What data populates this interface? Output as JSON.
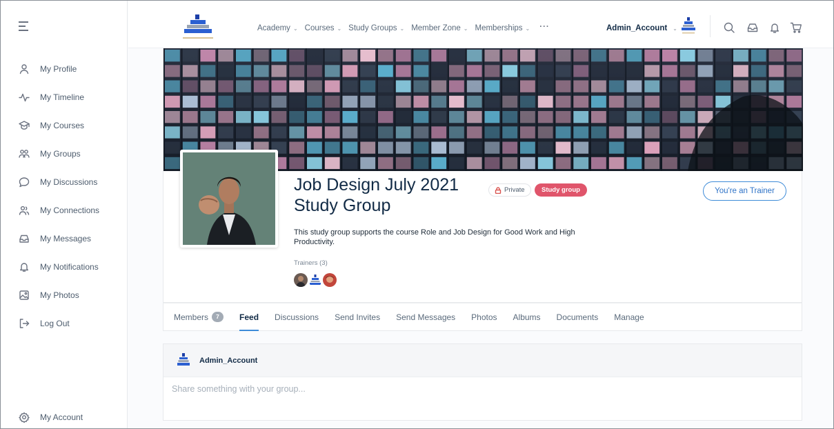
{
  "sidebar": {
    "items": [
      {
        "label": "My Profile",
        "icon": "user-icon"
      },
      {
        "label": "My Timeline",
        "icon": "activity-icon"
      },
      {
        "label": "My Courses",
        "icon": "graduation-cap-icon"
      },
      {
        "label": "My Groups",
        "icon": "users-icon"
      },
      {
        "label": "My Discussions",
        "icon": "chat-bubble-icon"
      },
      {
        "label": "My Connections",
        "icon": "user-connections-icon"
      },
      {
        "label": "My Messages",
        "icon": "inbox-icon"
      },
      {
        "label": "My Notifications",
        "icon": "bell-icon"
      },
      {
        "label": "My Photos",
        "icon": "image-icon"
      },
      {
        "label": "Log Out",
        "icon": "log-out-icon"
      }
    ],
    "account": {
      "label": "My Account",
      "icon": "gear-icon"
    }
  },
  "header": {
    "nav": [
      {
        "label": "Academy"
      },
      {
        "label": "Courses"
      },
      {
        "label": "Study Groups"
      },
      {
        "label": "Member Zone"
      },
      {
        "label": "Memberships"
      }
    ],
    "more": "···",
    "user_name": "Admin_Account",
    "icons": [
      "search-icon",
      "inbox-icon",
      "bell-icon",
      "cart-icon"
    ]
  },
  "group": {
    "title": "Job Design July 2021 Study Group",
    "privacy_badge": "Private",
    "type_badge": "Study group",
    "trainer_button": "You're an Trainer",
    "description": "This study group supports the course Role and Job Design for Good Work and High Productivity.",
    "trainers_label": "Trainers (3)"
  },
  "tabs": [
    {
      "label": "Members",
      "count": "7",
      "active": false
    },
    {
      "label": "Feed",
      "active": true
    },
    {
      "label": "Discussions",
      "active": false
    },
    {
      "label": "Send Invites",
      "active": false
    },
    {
      "label": "Send Messages",
      "active": false
    },
    {
      "label": "Photos",
      "active": false
    },
    {
      "label": "Albums",
      "active": false
    },
    {
      "label": "Documents",
      "active": false
    },
    {
      "label": "Manage",
      "active": false
    }
  ],
  "post": {
    "author": "Admin_Account",
    "placeholder": "Share something with your group..."
  },
  "colors": {
    "accent": "#3d8bd8",
    "study_group_badge": "#e0556b",
    "text_primary": "#122b46"
  }
}
